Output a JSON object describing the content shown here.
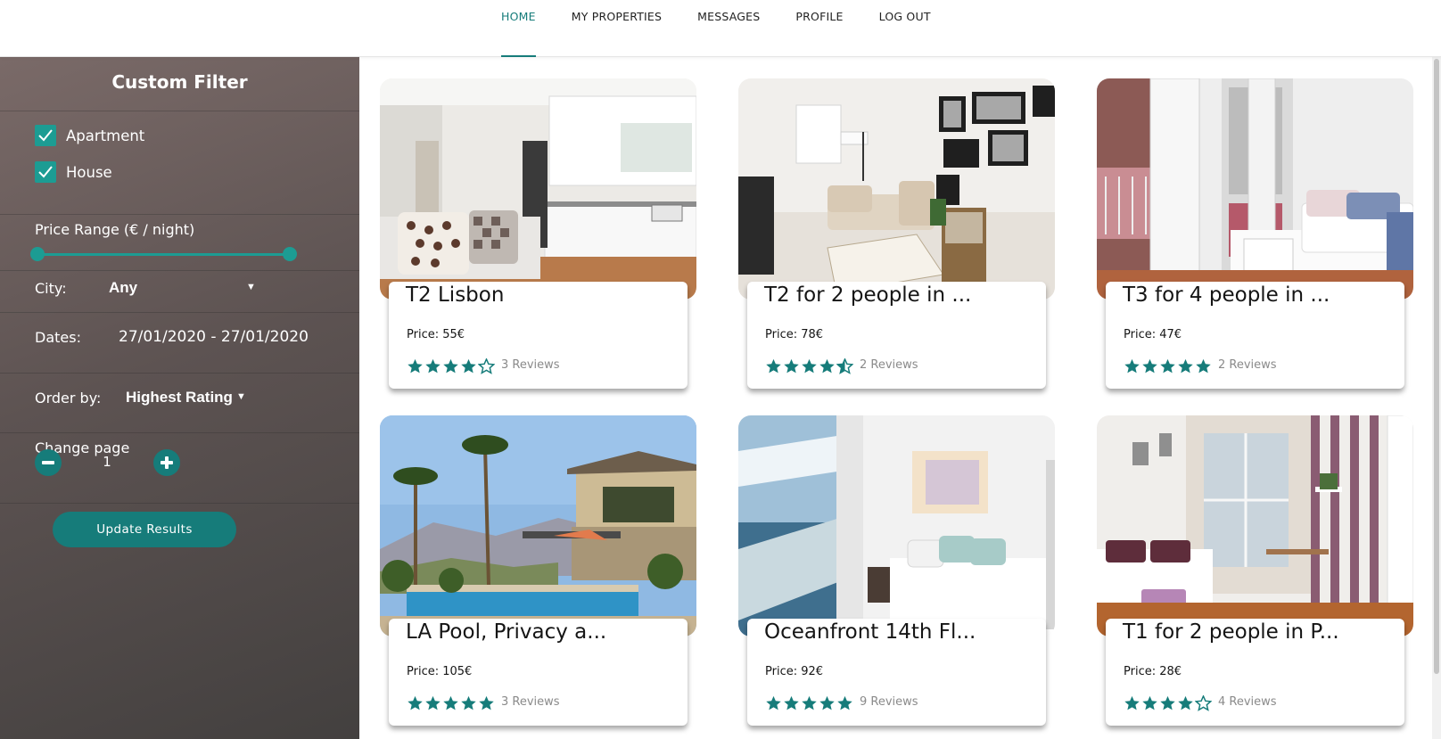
{
  "nav": {
    "items": [
      {
        "label": "HOME",
        "active": true
      },
      {
        "label": "MY PROPERTIES",
        "active": false
      },
      {
        "label": "MESSAGES",
        "active": false
      },
      {
        "label": "PROFILE",
        "active": false
      },
      {
        "label": "LOG OUT",
        "active": false
      }
    ]
  },
  "filter": {
    "title": "Custom Filter",
    "types": [
      {
        "label": "Apartment",
        "checked": true
      },
      {
        "label": "House",
        "checked": true
      }
    ],
    "price_range_label": "Price Range (€ / night)",
    "price_range_fraction": [
      0.0,
      1.0
    ],
    "city_label": "City:",
    "city_value": "Any",
    "dates_label": "Dates:",
    "dates_value": "27/01/2020 - 27/01/2020",
    "order_label": "Order by:",
    "order_value": "Highest Rating",
    "page_label": "Change page",
    "page_value": "1",
    "update_label": "Update Results"
  },
  "colors": {
    "accent": "#167c7a",
    "accent_light": "#1c9c93",
    "sidebar_top": "#7a6a68",
    "sidebar_bottom": "#43403f"
  },
  "listings": [
    {
      "title": "T2 Lisbon",
      "price": "Price: 55€",
      "rating": 4,
      "reviews": "3 Reviews",
      "scene": "kitchen"
    },
    {
      "title": "T2 for 2 people in ...",
      "price": "Price: 78€",
      "rating": 4.5,
      "reviews": "2 Reviews",
      "scene": "living"
    },
    {
      "title": "T3 for 4 people in ...",
      "price": "Price: 47€",
      "rating": 5,
      "reviews": "2 Reviews",
      "scene": "bedroom"
    },
    {
      "title": "LA Pool, Privacy a...",
      "price": "Price: 105€",
      "rating": 5,
      "reviews": "3 Reviews",
      "scene": "pool"
    },
    {
      "title": "Oceanfront 14th Fl...",
      "price": "Price: 92€",
      "rating": 5,
      "reviews": "9 Reviews",
      "scene": "ocean"
    },
    {
      "title": "T1 for 2 people in P...",
      "price": "Price: 28€",
      "rating": 4,
      "reviews": "4 Reviews",
      "scene": "studio"
    }
  ]
}
